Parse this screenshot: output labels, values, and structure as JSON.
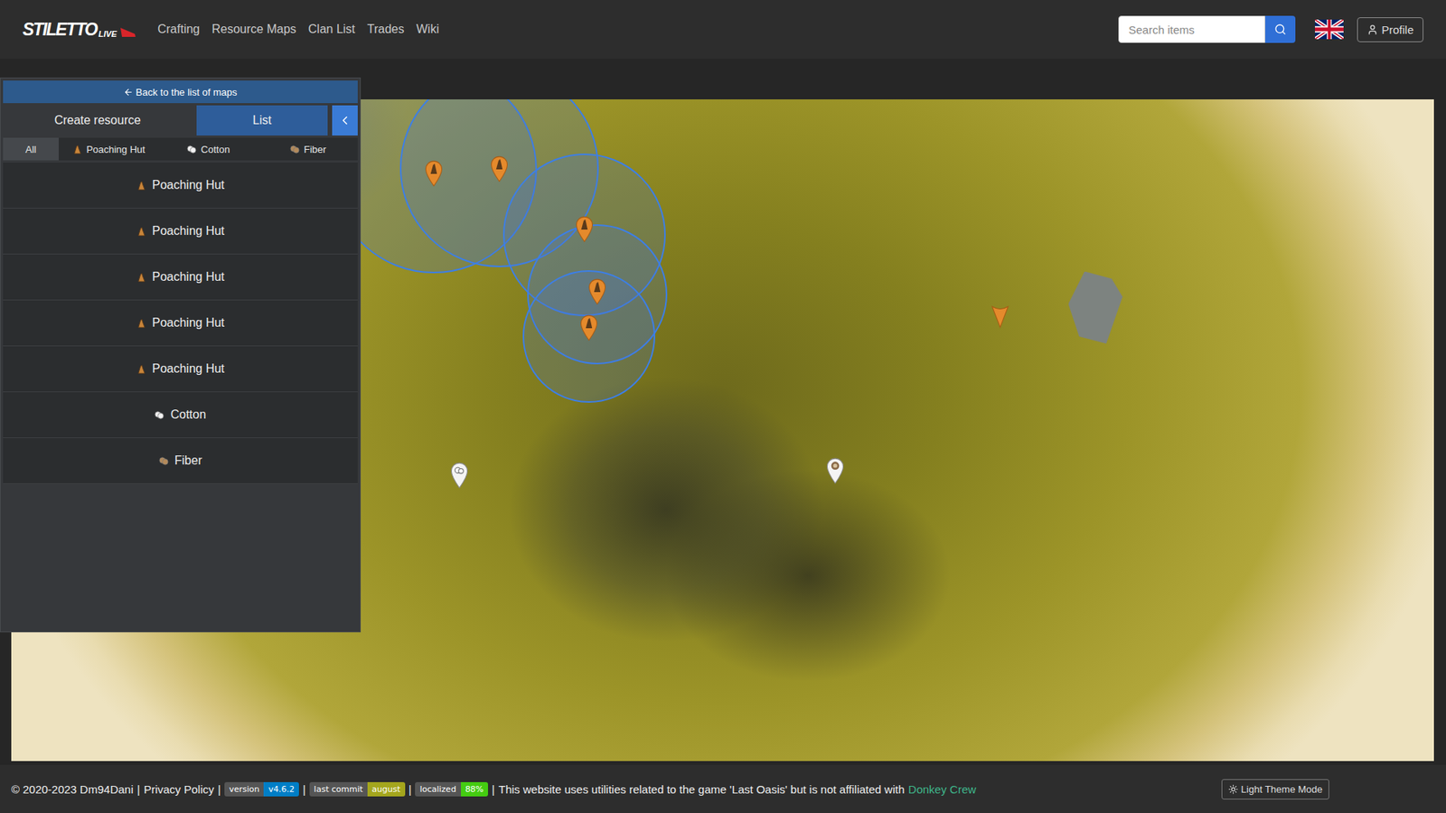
{
  "navbar": {
    "logo": {
      "name": "STILETTO",
      "suffix": "LIVE"
    },
    "links": [
      "Crafting",
      "Resource Maps",
      "Clan List",
      "Trades",
      "Wiki"
    ],
    "search": {
      "placeholder": "Search items"
    },
    "profile": "Profile"
  },
  "sidebar": {
    "back": "Back to the list of maps",
    "tabs": [
      {
        "label": "Create resource",
        "selected": false
      },
      {
        "label": "List",
        "selected": true
      }
    ],
    "filters": [
      {
        "label": "All",
        "kind": "all",
        "selected": true
      },
      {
        "label": "Poaching Hut",
        "kind": "poaching-hut",
        "selected": false
      },
      {
        "label": "Cotton",
        "kind": "cotton",
        "selected": false
      },
      {
        "label": "Fiber",
        "kind": "fiber",
        "selected": false
      }
    ],
    "items": [
      {
        "name": "Poaching Hut",
        "kind": "poaching-hut"
      },
      {
        "name": "Poaching Hut",
        "kind": "poaching-hut"
      },
      {
        "name": "Poaching Hut",
        "kind": "poaching-hut"
      },
      {
        "name": "Poaching Hut",
        "kind": "poaching-hut"
      },
      {
        "name": "Poaching Hut",
        "kind": "poaching-hut"
      },
      {
        "name": "Cotton",
        "kind": "cotton"
      },
      {
        "name": "Fiber",
        "kind": "fiber"
      }
    ]
  },
  "map": {
    "markers": [
      {
        "kind": "poaching-hut",
        "area": true
      },
      {
        "kind": "poaching-hut",
        "area": true
      },
      {
        "kind": "poaching-hut",
        "area": true
      },
      {
        "kind": "poaching-hut",
        "area": true
      },
      {
        "kind": "poaching-hut",
        "area": true
      },
      {
        "kind": "plain",
        "area": false
      },
      {
        "kind": "cotton",
        "area": false
      },
      {
        "kind": "fiber",
        "area": false
      }
    ]
  },
  "footer": {
    "copyright": "© 2020-2023 Dm94Dani",
    "separator": "|",
    "privacy": "Privacy Policy",
    "badges": [
      {
        "label": "version",
        "value": "v4.6.2",
        "color": "#007ec6"
      },
      {
        "label": "last commit",
        "value": "august",
        "color": "#a4a61d"
      },
      {
        "label": "localized",
        "value": "88%",
        "color": "#4c1"
      }
    ],
    "disclaimer": "This website uses utilities related to the game 'Last Oasis' but is not affiliated with",
    "link": "Donkey Crew",
    "theme_button": "Light Theme Mode"
  }
}
